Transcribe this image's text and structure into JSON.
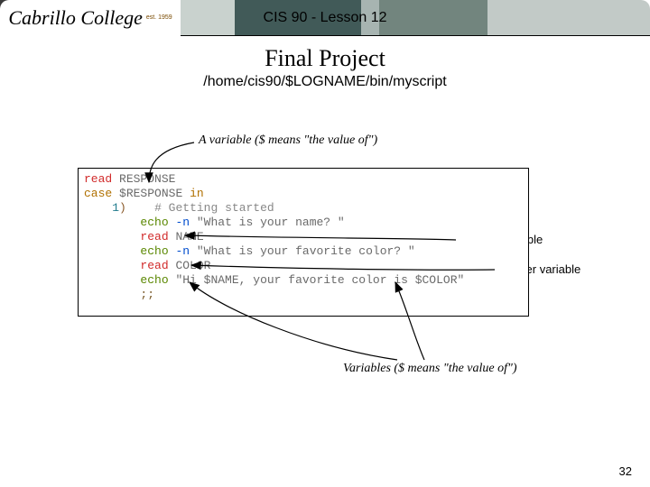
{
  "banner": {
    "logo_text": "Cabrillo College",
    "logo_est": "est. 1959",
    "title": "CIS 90 - Lesson 12"
  },
  "slide": {
    "title": "Final Project",
    "subtitle": "/home/cis90/$LOGNAME/bin/myscript"
  },
  "callouts": {
    "top": "A variable ($ means \"the value of\")",
    "right1": "another variable",
    "right2": "another variable",
    "bottom": "Variables ($ means \"the value of\")"
  },
  "code": {
    "l1_read": "read",
    "l1_var": "RESPONSE",
    "l2_case": "case",
    "l2_var": "$RESPONSE",
    "l2_in": "in",
    "l3_num": "1",
    "l3_paren": ")",
    "l3_cmt": "# Getting started",
    "l4_echo": "echo",
    "l4_opt": "-n",
    "l4_str": "\"What is your name? \"",
    "l5_read": "read",
    "l5_var": "NAME",
    "l6_echo": "echo",
    "l6_opt": "-n",
    "l6_str": "\"What is your favorite color? \"",
    "l7_read": "read",
    "l7_var": "COLOR",
    "l8_echo": "echo",
    "l8_str": "\"Hi $NAME, your favorite color is $COLOR\"",
    "l9_dsemi": ";;"
  },
  "page_number": "32"
}
